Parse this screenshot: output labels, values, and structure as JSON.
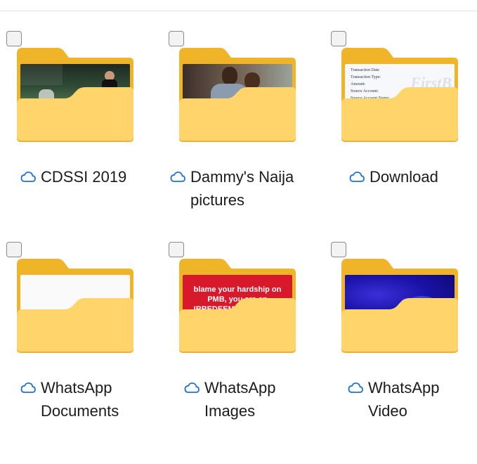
{
  "folders": [
    {
      "name": "CDSSI 2019",
      "thumbnail": "photo-outdoor-night",
      "sync_icon": "cloud-icon"
    },
    {
      "name": "Dammy's Naija\npictures",
      "thumbnail": "photo-couple",
      "sync_icon": "cloud-icon"
    },
    {
      "name": "Download",
      "thumbnail": "document-receipt",
      "sync_icon": "cloud-icon",
      "thumbnail_text": "Transaction Date"
    },
    {
      "name": "WhatsApp\nDocuments",
      "thumbnail": "blank-white",
      "sync_icon": "cloud-icon"
    },
    {
      "name": "WhatsApp\nImages",
      "thumbnail": "red-text-image",
      "sync_icon": "cloud-icon",
      "thumbnail_text": "blame your hardship on PMB, you are an IRREDEEMABLE FOOL."
    },
    {
      "name": "WhatsApp\nVideo",
      "thumbnail": "blue-stage-lights",
      "sync_icon": "cloud-icon"
    }
  ],
  "colors": {
    "folder_back": "#F0B429",
    "folder_front": "#FFD56B",
    "cloud": "#1E74D6",
    "checkbox_border": "#8A8A8A"
  }
}
